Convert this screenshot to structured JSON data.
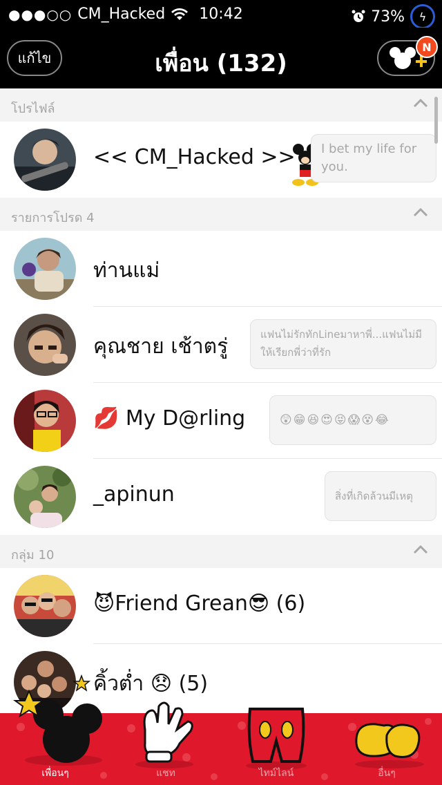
{
  "status_bar": {
    "signal": "●●●○○",
    "carrier": "CM_Hacked",
    "time": "10:42",
    "battery": "73%"
  },
  "nav": {
    "edit_label": "แก้ไข",
    "title": "เพื่อน (132)",
    "badge": "N"
  },
  "sections": {
    "profile": "โปรไฟล์",
    "favorites": "รายการโปรด 4",
    "groups": "กลุ่ม 10"
  },
  "profile": {
    "name": "<< CM_Hacked >>",
    "status": "I bet my life for you."
  },
  "favorites": [
    {
      "name": "ท่านแม่",
      "status": ""
    },
    {
      "name": "คุณชาย เช้าตรู่",
      "status": "แฟนไม่รักทักLineมาหาพี่...แฟนไม่มีให้เรียกพี่ว่าที่รัก"
    },
    {
      "name": "💋 My D@rling",
      "status": "😲😁😆😍😝😱😵😂"
    },
    {
      "name": "_apinun",
      "status": "สิ่งที่เกิดล้วนมีเหตุ"
    }
  ],
  "groups": [
    {
      "name": "😈Friend Grean😎  (6)"
    },
    {
      "name": "คิ้วต่ำ 😞  (5)"
    }
  ],
  "tabs": [
    {
      "label": "เพื่อนๆ"
    },
    {
      "label": "แชท"
    },
    {
      "label": "ไทม์ไลน์"
    },
    {
      "label": "อื่นๆ"
    }
  ],
  "colors": {
    "tabbar": "#e0182b",
    "badge": "#f24a1e",
    "navbar": "#000000"
  }
}
